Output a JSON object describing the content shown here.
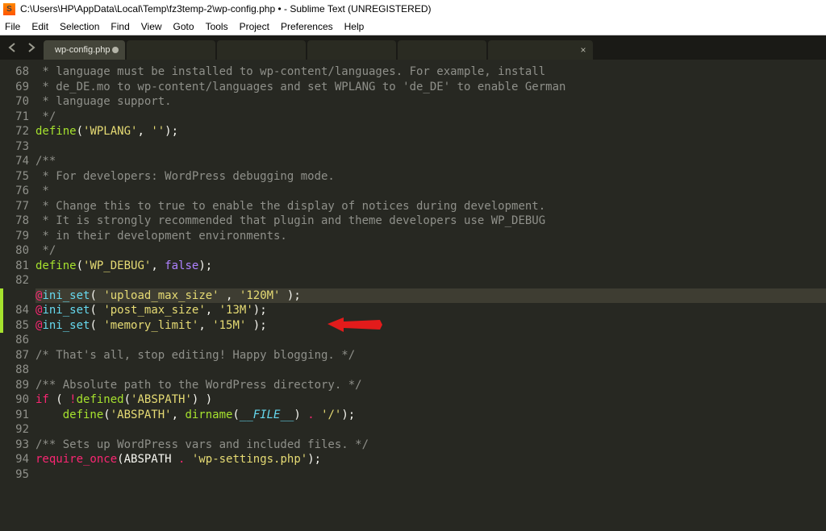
{
  "titlebar": {
    "text": "C:\\Users\\HP\\AppData\\Local\\Temp\\fz3temp-2\\wp-config.php • - Sublime Text (UNREGISTERED)"
  },
  "menubar": [
    "File",
    "Edit",
    "Selection",
    "Find",
    "View",
    "Goto",
    "Tools",
    "Project",
    "Preferences",
    "Help"
  ],
  "tabs": {
    "active_label": "wp-config.php"
  },
  "lines": {
    "start": 68,
    "end": 95,
    "highlighted": 83,
    "marked_start": 83,
    "marked_end": 85
  },
  "code": {
    "68": [
      [
        "c-comment",
        " * language must be installed to wp-content/languages. For example, install"
      ]
    ],
    "69": [
      [
        "c-comment",
        " * de_DE.mo to wp-content/languages and set WPLANG to 'de_DE' to enable German"
      ]
    ],
    "70": [
      [
        "c-comment",
        " * language support."
      ]
    ],
    "71": [
      [
        "c-comment",
        " */"
      ]
    ],
    "72": [
      [
        "c-key",
        "define"
      ],
      [
        "c-plain",
        "("
      ],
      [
        "c-str",
        "'WPLANG'"
      ],
      [
        "c-plain",
        ", "
      ],
      [
        "c-str",
        "''"
      ],
      [
        "c-plain",
        ");"
      ]
    ],
    "73": [
      [
        "c-plain",
        ""
      ]
    ],
    "74": [
      [
        "c-comment",
        "/**"
      ]
    ],
    "75": [
      [
        "c-comment",
        " * For developers: WordPress debugging mode."
      ]
    ],
    "76": [
      [
        "c-comment",
        " *"
      ]
    ],
    "77": [
      [
        "c-comment",
        " * Change this to true to enable the display of notices during development."
      ]
    ],
    "78": [
      [
        "c-comment",
        " * It is strongly recommended that plugin and theme developers use WP_DEBUG"
      ]
    ],
    "79": [
      [
        "c-comment",
        " * in their development environments."
      ]
    ],
    "80": [
      [
        "c-comment",
        " */"
      ]
    ],
    "81": [
      [
        "c-key",
        "define"
      ],
      [
        "c-plain",
        "("
      ],
      [
        "c-str",
        "'WP_DEBUG'"
      ],
      [
        "c-plain",
        ", "
      ],
      [
        "c-const",
        "false"
      ],
      [
        "c-plain",
        ");"
      ]
    ],
    "82": [
      [
        "c-plain",
        ""
      ]
    ],
    "83": [
      [
        "c-kw",
        "@"
      ],
      [
        "c-key2",
        "ini_set"
      ],
      [
        "c-plain",
        "( "
      ],
      [
        "c-str",
        "'upload_max_size'"
      ],
      [
        "c-plain",
        " , "
      ],
      [
        "c-str",
        "'120M'"
      ],
      [
        "c-plain",
        " );"
      ]
    ],
    "84": [
      [
        "c-kw",
        "@"
      ],
      [
        "c-key2",
        "ini_set"
      ],
      [
        "c-plain",
        "( "
      ],
      [
        "c-str",
        "'post_max_size'"
      ],
      [
        "c-plain",
        ", "
      ],
      [
        "c-str",
        "'13M'"
      ],
      [
        "c-plain",
        ");"
      ]
    ],
    "85": [
      [
        "c-kw",
        "@"
      ],
      [
        "c-key2",
        "ini_set"
      ],
      [
        "c-plain",
        "( "
      ],
      [
        "c-str",
        "'memory_limit'"
      ],
      [
        "c-plain",
        ", "
      ],
      [
        "c-str",
        "'15M'"
      ],
      [
        "c-plain",
        " );"
      ]
    ],
    "86": [
      [
        "c-plain",
        ""
      ]
    ],
    "87": [
      [
        "c-comment",
        "/* That's all, stop editing! Happy blogging. */"
      ]
    ],
    "88": [
      [
        "c-plain",
        ""
      ]
    ],
    "89": [
      [
        "c-comment",
        "/** Absolute path to the WordPress directory. */"
      ]
    ],
    "90": [
      [
        "c-kw",
        "if"
      ],
      [
        "c-plain",
        " ( "
      ],
      [
        "c-kw",
        "!"
      ],
      [
        "c-key",
        "defined"
      ],
      [
        "c-plain",
        "("
      ],
      [
        "c-str",
        "'ABSPATH'"
      ],
      [
        "c-plain",
        ") )"
      ]
    ],
    "91": [
      [
        "c-plain",
        "    "
      ],
      [
        "c-key",
        "define"
      ],
      [
        "c-plain",
        "("
      ],
      [
        "c-str",
        "'ABSPATH'"
      ],
      [
        "c-plain",
        ", "
      ],
      [
        "c-key",
        "dirname"
      ],
      [
        "c-plain",
        "("
      ],
      [
        "c-var",
        "__FILE__"
      ],
      [
        "c-plain",
        ") "
      ],
      [
        "c-kw",
        "."
      ],
      [
        "c-plain",
        " "
      ],
      [
        "c-str",
        "'/'"
      ],
      [
        "c-plain",
        ");"
      ]
    ],
    "92": [
      [
        "c-plain",
        ""
      ]
    ],
    "93": [
      [
        "c-comment",
        "/** Sets up WordPress vars and included files. */"
      ]
    ],
    "94": [
      [
        "c-kw",
        "require_once"
      ],
      [
        "c-plain",
        "("
      ],
      [
        "c-plain",
        "ABSPATH "
      ],
      [
        "c-kw",
        "."
      ],
      [
        "c-plain",
        " "
      ],
      [
        "c-str",
        "'wp-settings.php'"
      ],
      [
        "c-plain",
        ");"
      ]
    ],
    "95": [
      [
        "c-plain",
        ""
      ]
    ]
  }
}
